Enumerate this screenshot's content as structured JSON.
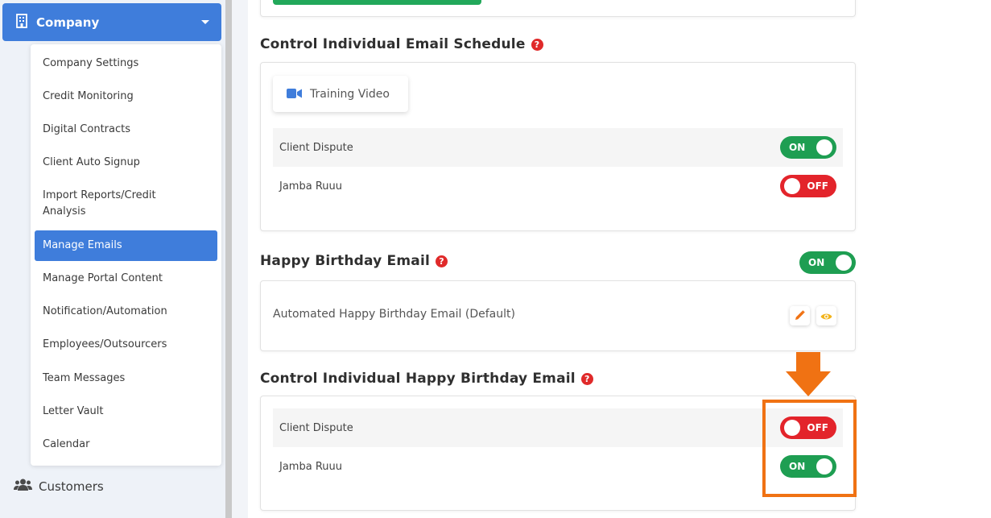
{
  "sidebar": {
    "company_label": "Company",
    "submenu": [
      "Company Settings",
      "Credit Monitoring",
      "Digital Contracts",
      "Client Auto Signup",
      "Import Reports/Credit Analysis",
      "Manage Emails",
      "Manage Portal Content",
      "Notification/Automation",
      "Employees/Outsourcers",
      "Team Messages",
      "Letter Vault",
      "Calendar"
    ],
    "active_item": "Manage Emails",
    "customers_label": "Customers"
  },
  "schedule": {
    "title": "Control Individual Email Schedule",
    "help": "?",
    "video_label": "Training Video",
    "rows": [
      {
        "name": "Client Dispute",
        "toggle": "ON"
      },
      {
        "name": "Jamba Ruuu",
        "toggle": "OFF"
      }
    ]
  },
  "birthday": {
    "title": "Happy Birthday Email",
    "help": "?",
    "toggle": "ON",
    "template_name": "Automated Happy Birthday Email (Default)"
  },
  "individual_birthday": {
    "title": "Control Individual Happy Birthday Email",
    "help": "?",
    "rows": [
      {
        "name": "Client Dispute",
        "toggle": "OFF"
      },
      {
        "name": "Jamba Ruuu",
        "toggle": "ON"
      }
    ]
  },
  "colors": {
    "primary": "#3f7ddb",
    "on": "#1e9e52",
    "off": "#e3242b",
    "help": "#e02a2a",
    "annotation": "#f07213"
  }
}
